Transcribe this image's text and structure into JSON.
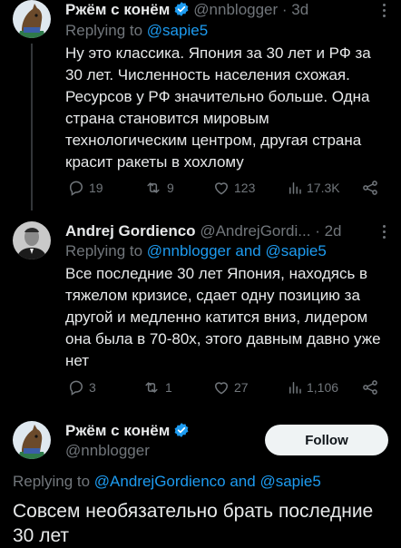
{
  "tweet1": {
    "author_name": "Ржём с конём",
    "handle": "@nnblogger",
    "time": "· 3d",
    "replying_prefix": "Replying to",
    "replying_user": "@sapie5",
    "text": "Ну это классика. Япония за 30 лет и РФ за 30 лет. Численность населения схожая. Ресурсов у РФ значительно больше. Одна страна становится мировым технологическим центром, другая страна красит ракеты в хохлому",
    "replies": "19",
    "reposts": "9",
    "likes": "123",
    "views": "17.3K"
  },
  "tweet2": {
    "author_name": "Andrej Gordienco",
    "handle": "@AndrejGordi...",
    "time": "· 2d",
    "replying_prefix": "Replying to",
    "replying_users": "@nnblogger and @sapie5",
    "text": "Все последние 30 лет Япония, находясь в тяжелом кризисе, сдает одну позицию за другой и медленно катится вниз, лидером она была в 70-80х, этого давным давно уже нет",
    "replies": "3",
    "reposts": "1",
    "likes": "27",
    "views": "1,106"
  },
  "focused": {
    "author_name": "Ржём с конём",
    "handle": "@nnblogger",
    "follow_label": "Follow",
    "replying_prefix": "Replying to",
    "replying_users": "@AndrejGordienco and @sapie5",
    "text": "Совсем необязательно брать последние 30 лет"
  },
  "colors": {
    "accent": "#1d9bf0",
    "verified": "#1d9bf0",
    "muted": "#71767b",
    "background": "#000000"
  }
}
